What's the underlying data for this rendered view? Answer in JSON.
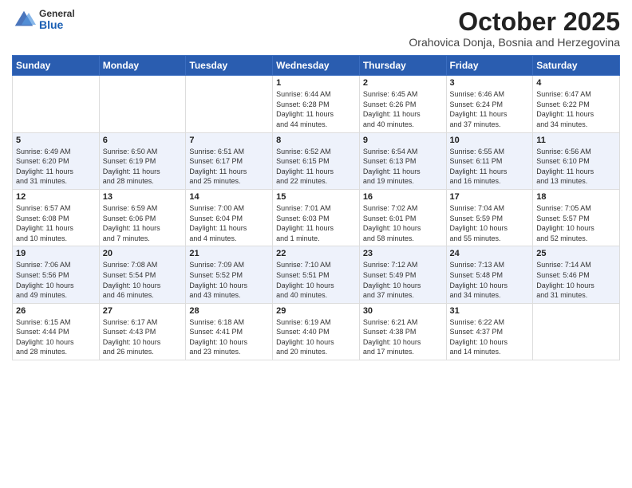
{
  "header": {
    "logo_general": "General",
    "logo_blue": "Blue",
    "month_title": "October 2025",
    "location": "Orahovica Donja, Bosnia and Herzegovina"
  },
  "weekdays": [
    "Sunday",
    "Monday",
    "Tuesday",
    "Wednesday",
    "Thursday",
    "Friday",
    "Saturday"
  ],
  "weeks": [
    [
      {
        "day": "",
        "info": ""
      },
      {
        "day": "",
        "info": ""
      },
      {
        "day": "",
        "info": ""
      },
      {
        "day": "1",
        "info": "Sunrise: 6:44 AM\nSunset: 6:28 PM\nDaylight: 11 hours\nand 44 minutes."
      },
      {
        "day": "2",
        "info": "Sunrise: 6:45 AM\nSunset: 6:26 PM\nDaylight: 11 hours\nand 40 minutes."
      },
      {
        "day": "3",
        "info": "Sunrise: 6:46 AM\nSunset: 6:24 PM\nDaylight: 11 hours\nand 37 minutes."
      },
      {
        "day": "4",
        "info": "Sunrise: 6:47 AM\nSunset: 6:22 PM\nDaylight: 11 hours\nand 34 minutes."
      }
    ],
    [
      {
        "day": "5",
        "info": "Sunrise: 6:49 AM\nSunset: 6:20 PM\nDaylight: 11 hours\nand 31 minutes."
      },
      {
        "day": "6",
        "info": "Sunrise: 6:50 AM\nSunset: 6:19 PM\nDaylight: 11 hours\nand 28 minutes."
      },
      {
        "day": "7",
        "info": "Sunrise: 6:51 AM\nSunset: 6:17 PM\nDaylight: 11 hours\nand 25 minutes."
      },
      {
        "day": "8",
        "info": "Sunrise: 6:52 AM\nSunset: 6:15 PM\nDaylight: 11 hours\nand 22 minutes."
      },
      {
        "day": "9",
        "info": "Sunrise: 6:54 AM\nSunset: 6:13 PM\nDaylight: 11 hours\nand 19 minutes."
      },
      {
        "day": "10",
        "info": "Sunrise: 6:55 AM\nSunset: 6:11 PM\nDaylight: 11 hours\nand 16 minutes."
      },
      {
        "day": "11",
        "info": "Sunrise: 6:56 AM\nSunset: 6:10 PM\nDaylight: 11 hours\nand 13 minutes."
      }
    ],
    [
      {
        "day": "12",
        "info": "Sunrise: 6:57 AM\nSunset: 6:08 PM\nDaylight: 11 hours\nand 10 minutes."
      },
      {
        "day": "13",
        "info": "Sunrise: 6:59 AM\nSunset: 6:06 PM\nDaylight: 11 hours\nand 7 minutes."
      },
      {
        "day": "14",
        "info": "Sunrise: 7:00 AM\nSunset: 6:04 PM\nDaylight: 11 hours\nand 4 minutes."
      },
      {
        "day": "15",
        "info": "Sunrise: 7:01 AM\nSunset: 6:03 PM\nDaylight: 11 hours\nand 1 minute."
      },
      {
        "day": "16",
        "info": "Sunrise: 7:02 AM\nSunset: 6:01 PM\nDaylight: 10 hours\nand 58 minutes."
      },
      {
        "day": "17",
        "info": "Sunrise: 7:04 AM\nSunset: 5:59 PM\nDaylight: 10 hours\nand 55 minutes."
      },
      {
        "day": "18",
        "info": "Sunrise: 7:05 AM\nSunset: 5:57 PM\nDaylight: 10 hours\nand 52 minutes."
      }
    ],
    [
      {
        "day": "19",
        "info": "Sunrise: 7:06 AM\nSunset: 5:56 PM\nDaylight: 10 hours\nand 49 minutes."
      },
      {
        "day": "20",
        "info": "Sunrise: 7:08 AM\nSunset: 5:54 PM\nDaylight: 10 hours\nand 46 minutes."
      },
      {
        "day": "21",
        "info": "Sunrise: 7:09 AM\nSunset: 5:52 PM\nDaylight: 10 hours\nand 43 minutes."
      },
      {
        "day": "22",
        "info": "Sunrise: 7:10 AM\nSunset: 5:51 PM\nDaylight: 10 hours\nand 40 minutes."
      },
      {
        "day": "23",
        "info": "Sunrise: 7:12 AM\nSunset: 5:49 PM\nDaylight: 10 hours\nand 37 minutes."
      },
      {
        "day": "24",
        "info": "Sunrise: 7:13 AM\nSunset: 5:48 PM\nDaylight: 10 hours\nand 34 minutes."
      },
      {
        "day": "25",
        "info": "Sunrise: 7:14 AM\nSunset: 5:46 PM\nDaylight: 10 hours\nand 31 minutes."
      }
    ],
    [
      {
        "day": "26",
        "info": "Sunrise: 6:15 AM\nSunset: 4:44 PM\nDaylight: 10 hours\nand 28 minutes."
      },
      {
        "day": "27",
        "info": "Sunrise: 6:17 AM\nSunset: 4:43 PM\nDaylight: 10 hours\nand 26 minutes."
      },
      {
        "day": "28",
        "info": "Sunrise: 6:18 AM\nSunset: 4:41 PM\nDaylight: 10 hours\nand 23 minutes."
      },
      {
        "day": "29",
        "info": "Sunrise: 6:19 AM\nSunset: 4:40 PM\nDaylight: 10 hours\nand 20 minutes."
      },
      {
        "day": "30",
        "info": "Sunrise: 6:21 AM\nSunset: 4:38 PM\nDaylight: 10 hours\nand 17 minutes."
      },
      {
        "day": "31",
        "info": "Sunrise: 6:22 AM\nSunset: 4:37 PM\nDaylight: 10 hours\nand 14 minutes."
      },
      {
        "day": "",
        "info": ""
      }
    ]
  ]
}
